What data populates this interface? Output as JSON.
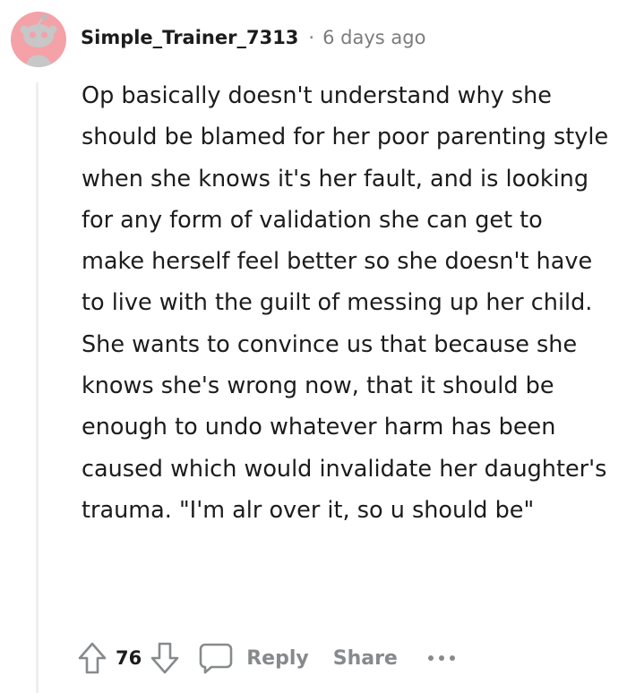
{
  "comment": {
    "author": "Simple_Trainer_7313",
    "separator": "·",
    "timestamp": "6 days ago",
    "body": "Op basically doesn't understand why she should be blamed for her poor parenting style when she knows it's her fault, and is looking for any form of validation she can get to make herself feel better so she doesn't have to live with the guilt of messing up her child. She wants to convince us that because she knows she's wrong now, that it should be enough to undo whatever harm has been caused which would invalidate her daughter's trauma. \"I'm alr over it, so u should be\"",
    "avatar_color": "#f4a1a8"
  },
  "actions": {
    "upvote_icon": "arrow-up-outline-icon",
    "vote_count": "76",
    "downvote_icon": "arrow-down-outline-icon",
    "comment_icon": "speech-bubble-icon",
    "reply_label": "Reply",
    "share_label": "Share",
    "more_icon": "ellipsis-icon"
  }
}
